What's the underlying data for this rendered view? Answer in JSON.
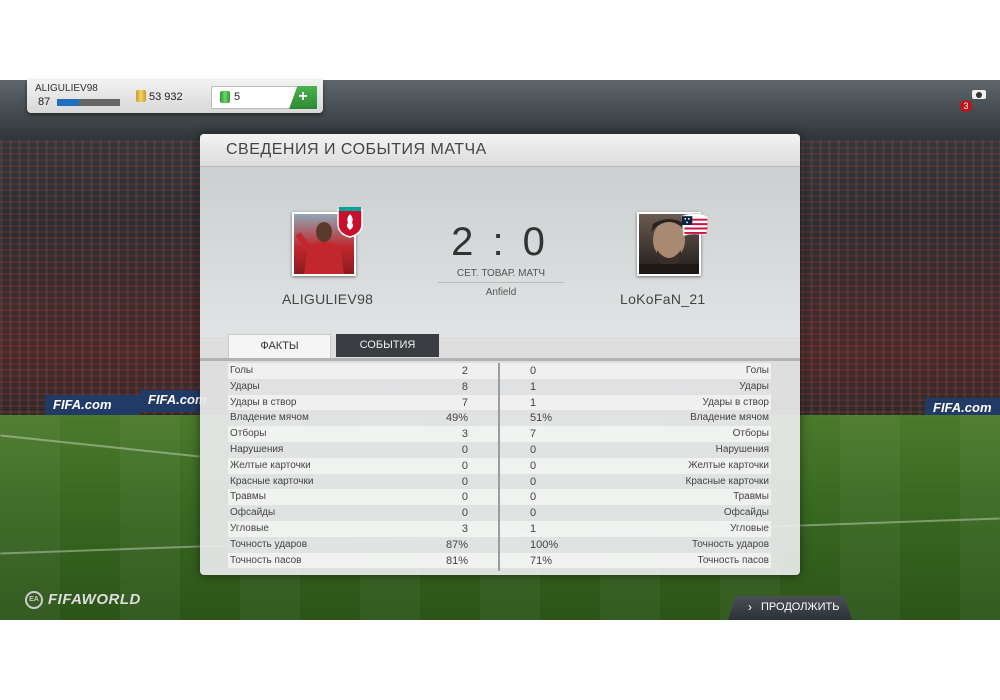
{
  "topbar": {
    "username": "ALIGULIEV98",
    "level": "87",
    "xp_progress": 0.35,
    "coins": "53 932",
    "points": "5",
    "add_label": "+"
  },
  "notifications": {
    "count": "3"
  },
  "panel": {
    "title": "СВЕДЕНИЯ И СОБЫТИЯ МАТЧА",
    "home_name": "ALIGULIEV98",
    "away_name": "LoKoFaN_21",
    "score": "2 : 0",
    "match_type": "СЕТ. ТОВАР. МАТЧ",
    "stadium": "Anfield",
    "tabs": {
      "facts": "ФАКТЫ",
      "events": "СОБЫТИЯ"
    }
  },
  "stats": [
    {
      "label": "Голы",
      "home": "2",
      "away": "0"
    },
    {
      "label": "Удары",
      "home": "8",
      "away": "1"
    },
    {
      "label": "Удары в створ",
      "home": "7",
      "away": "1"
    },
    {
      "label": "Владение мячом",
      "home": "49%",
      "away": "51%"
    },
    {
      "label": "Отборы",
      "home": "3",
      "away": "7"
    },
    {
      "label": "Нарушения",
      "home": "0",
      "away": "0"
    },
    {
      "label": "Желтые карточки",
      "home": "0",
      "away": "0"
    },
    {
      "label": "Красные карточки",
      "home": "0",
      "away": "0"
    },
    {
      "label": "Травмы",
      "home": "0",
      "away": "0"
    },
    {
      "label": "Офсайды",
      "home": "0",
      "away": "0"
    },
    {
      "label": "Угловые",
      "home": "3",
      "away": "1"
    },
    {
      "label": "Точность ударов",
      "home": "87%",
      "away": "100%"
    },
    {
      "label": "Точность пасов",
      "home": "81%",
      "away": "71%"
    }
  ],
  "brand": {
    "ea": "EA",
    "name": "FIFAWORLD"
  },
  "continue_label": "ПРОДОЛЖИТЬ",
  "ads": {
    "left1": "FIFA.com",
    "left2": "FIFA.com",
    "right1": "FIFA.com"
  },
  "colors": {
    "accent_green": "#3aa040",
    "xp_blue": "#1e6fbf",
    "badge_red": "#c0141b",
    "tab_dark": "#3a3e42"
  }
}
